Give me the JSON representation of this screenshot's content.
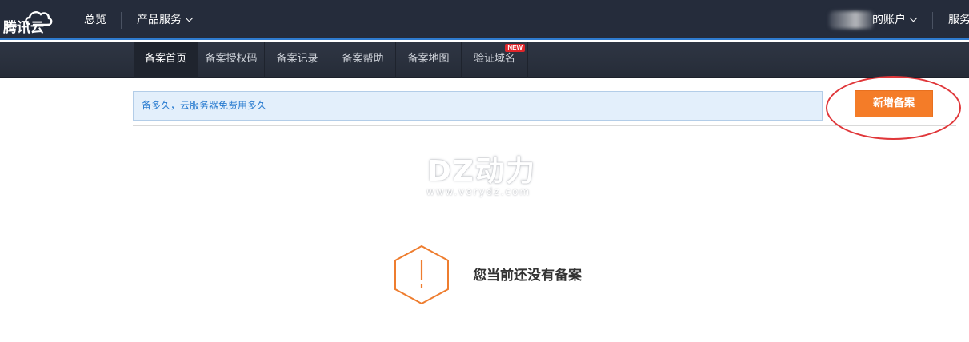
{
  "topbar": {
    "logo_text": "腾讯云",
    "nav": [
      {
        "label": "总览"
      },
      {
        "label": "产品服务"
      }
    ],
    "account_label": "的账户",
    "service_label": "服务"
  },
  "subnav": {
    "tabs": [
      {
        "label": "备案首页",
        "active": true
      },
      {
        "label": "备案授权码"
      },
      {
        "label": "备案记录"
      },
      {
        "label": "备案帮助"
      },
      {
        "label": "备案地图"
      },
      {
        "label": "验证域名",
        "badge": "NEW"
      }
    ]
  },
  "notice": {
    "text": "备多久，云服务器免费用多久"
  },
  "actions": {
    "add_label": "新增备案"
  },
  "watermark": {
    "main": "DZ动力",
    "sub": "www.verydz.com"
  },
  "empty_state": {
    "text": "您当前还没有备案"
  },
  "colors": {
    "topbar_bg": "#252c3b",
    "accent_blue": "#2e7bcf",
    "primary_button": "#f47c28",
    "highlight_circle": "#e0373a",
    "empty_icon": "#ee7d2f"
  }
}
